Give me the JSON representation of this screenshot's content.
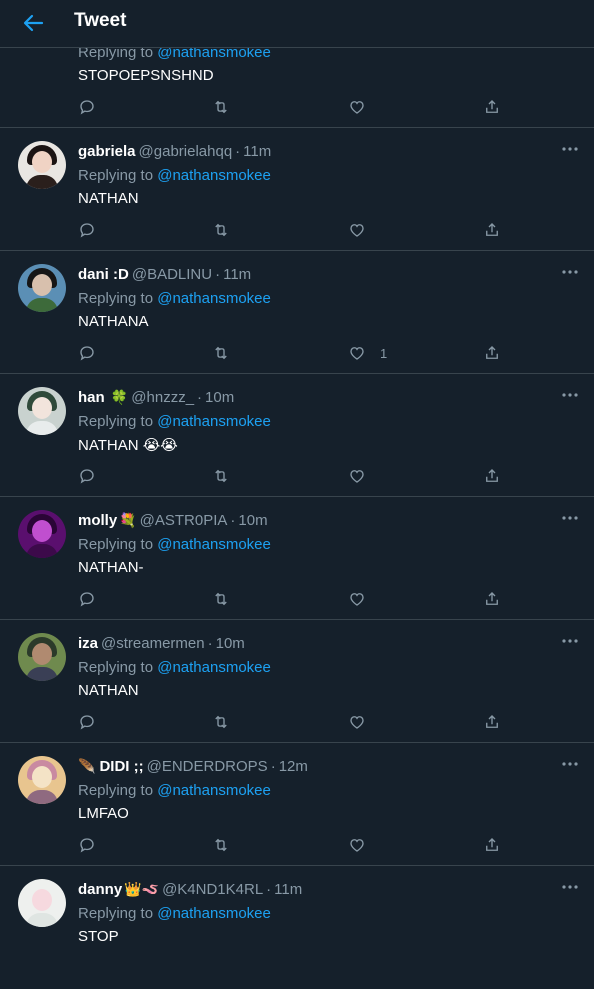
{
  "header": {
    "title": "Tweet"
  },
  "colors": {
    "background": "#15202b",
    "border": "#38444d",
    "muted": "#8899a6",
    "accent": "#1da1f2"
  },
  "replying_label": "Replying to",
  "tweets": [
    {
      "name": "",
      "emoji": "",
      "handle": "",
      "time": "",
      "reply_to": "@nathansmokee",
      "text": "STOPOEPSNSHND",
      "likes": "",
      "avatar": "pink-blob"
    },
    {
      "name": "gabriela",
      "emoji": "",
      "handle": "@gabrielahqq",
      "time": "11m",
      "reply_to": "@nathansmokee",
      "text": "NATHAN",
      "likes": "",
      "avatar": "girl-dark-hair"
    },
    {
      "name": "dani :D",
      "emoji": "",
      "handle": "@BADLINU",
      "time": "11m",
      "reply_to": "@nathansmokee",
      "text": "NATHANA",
      "likes": "1",
      "avatar": "person-blue-bg"
    },
    {
      "name": "han",
      "emoji": "🍀",
      "handle": "@hnzzz_",
      "time": "10m",
      "reply_to": "@nathansmokee",
      "text": "NATHAN 😭😭",
      "likes": "",
      "avatar": "anime-green-hair"
    },
    {
      "name": "molly",
      "emoji": "💐",
      "handle": "@ASTR0PIA",
      "time": "10m",
      "reply_to": "@nathansmokee",
      "text": "NATHAN-",
      "likes": "",
      "avatar": "purple-portrait"
    },
    {
      "name": "iza",
      "emoji": "",
      "handle": "@streamermen",
      "time": "10m",
      "reply_to": "@nathansmokee",
      "text": "NATHAN",
      "likes": "",
      "avatar": "group-photo"
    },
    {
      "name": "DIDI ;;",
      "emoji": "🪶",
      "handle": "@ENDERDROPS",
      "time": "12m",
      "reply_to": "@nathansmokee",
      "text": "LMFAO",
      "likes": "",
      "avatar": "drawing-pink"
    },
    {
      "name": "danny",
      "emoji": "👑🪱",
      "handle": "@K4ND1K4RL",
      "time": "11m",
      "reply_to": "@nathansmokee",
      "text": "STOP",
      "likes": "",
      "avatar": "white-cat"
    }
  ]
}
